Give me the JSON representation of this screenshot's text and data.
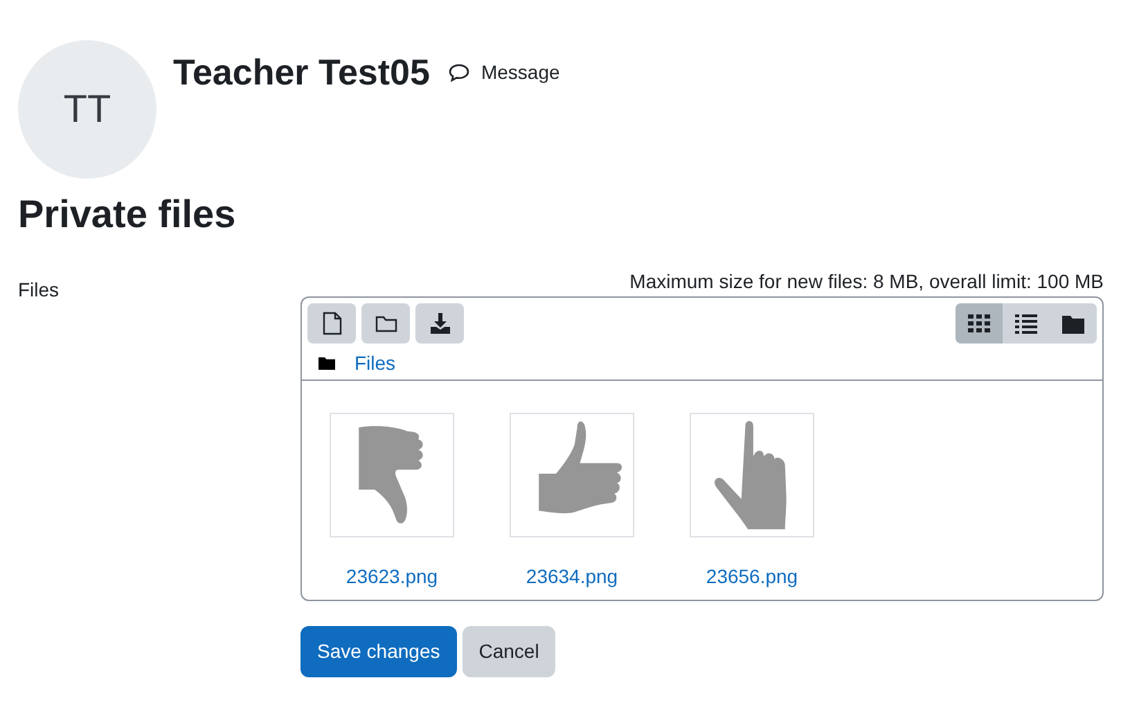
{
  "user": {
    "initials": "TT",
    "name": "Teacher Test05",
    "message_link": "Message"
  },
  "page_title": "Private files",
  "field_label": "Files",
  "limits": "Maximum size for new files: 8 MB, overall limit: 100 MB",
  "view_modes": [
    {
      "kind": "icons",
      "selected": true
    },
    {
      "kind": "list",
      "selected": false
    },
    {
      "kind": "tree",
      "selected": false
    }
  ],
  "breadcrumb": "Files",
  "files": [
    {
      "name": "23623.png",
      "kind": "thumbs-down"
    },
    {
      "name": "23634.png",
      "kind": "thumbs-up"
    },
    {
      "name": "23656.png",
      "kind": "pointing"
    }
  ],
  "buttons": [
    {
      "label": "Save changes",
      "kind": "primary"
    },
    {
      "label": "Cancel",
      "kind": "secondary"
    }
  ]
}
